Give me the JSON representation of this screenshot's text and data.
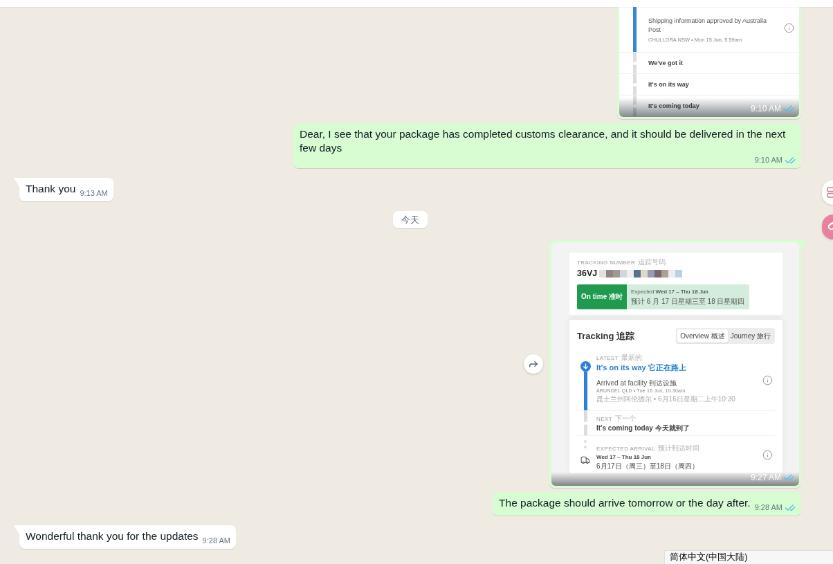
{
  "messages": [
    {
      "kind": "image",
      "outgoing": true,
      "time": "9:10 AM",
      "read": true,
      "image": {
        "kind": "tracking_events",
        "events": [
          {
            "title": "Shipping information approved by Australia Post",
            "detail": "CHULLORA NSW • Mon 15 Jun, 5.59am",
            "done": true
          },
          {
            "title": "We've got it",
            "done": false
          },
          {
            "title": "It's on its way",
            "done": false
          },
          {
            "title": "It's coming today",
            "done": false
          }
        ]
      }
    },
    {
      "kind": "text",
      "outgoing": true,
      "text": "Dear, I see that your package has completed customs clearance, and it should be delivered in the next few days",
      "time": "9:10 AM",
      "read": true
    },
    {
      "kind": "text",
      "outgoing": false,
      "text": "Thank you",
      "time": "9:13 AM"
    },
    {
      "kind": "date",
      "label": "今天"
    },
    {
      "kind": "image",
      "outgoing": true,
      "time": "9:27 AM",
      "read": true,
      "forward_button": true,
      "image": {
        "kind": "tracking_summary",
        "number_label": "TRACKING NUMBER",
        "number_label_zh": "追踪号码",
        "number": "36VJ",
        "status": "On time 准时",
        "expected": "Expected **Wed 17 – Thu 18 Jun**",
        "expected_zh": "预计 6 月 17 日星期三至 18 日星期四",
        "section_title": "Tracking 追踪",
        "tabs": [
          {
            "label": "Overview 概述",
            "selected": true
          },
          {
            "label": "Journey 旅行",
            "selected": false
          }
        ],
        "steps": [
          {
            "kind": "latest",
            "label": "LATEST",
            "label_zh": "最新的",
            "title": "It's on its way 它正在路上",
            "event": "Arrived at facility 到达设施",
            "detail": "ARUNDEL QLD • Tue 16 Jun, 10.30am",
            "detail_zh": "昆士兰州阿伦德尔 • 6月16日星期二上午10:30"
          },
          {
            "kind": "next",
            "label": "NEXT",
            "label_zh": "下一个",
            "title": "It's coming today 今天就到了"
          },
          {
            "kind": "arrival",
            "label": "EXPECTED ARRIVAL",
            "label_zh": "预计到达时间",
            "title": "Wed 17 – Thu 18 Jun",
            "detail_zh": "6月17日（周三）至18日（周四）"
          }
        ]
      }
    },
    {
      "kind": "text",
      "outgoing": true,
      "text": "The package should arrive tomorrow or the day after.",
      "time": "9:28 AM",
      "read": true
    },
    {
      "kind": "text",
      "outgoing": false,
      "text": "Wonderful thank you for the updates",
      "time": "9:28 AM"
    }
  ],
  "ime_indicator": {
    "label": "简体中文(中国大陆)"
  }
}
